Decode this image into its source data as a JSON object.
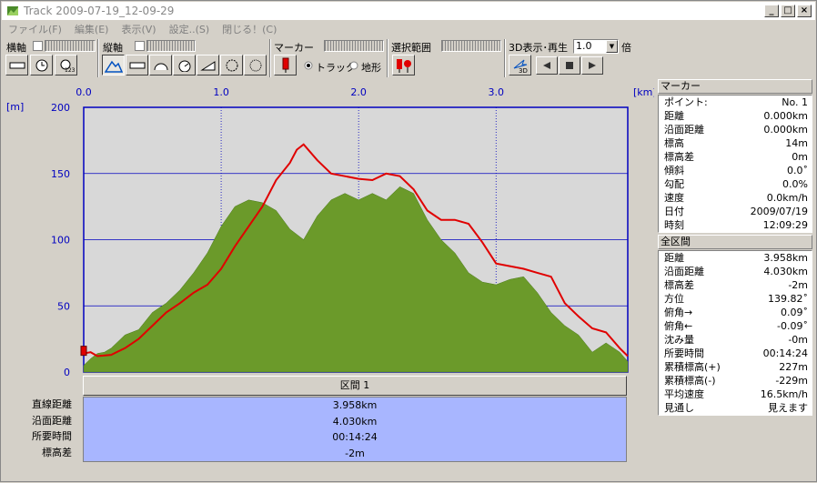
{
  "window": {
    "title": "Track  2009-07-19_12-09-29",
    "min": "_",
    "max": "□",
    "close": "×"
  },
  "menu": [
    "ファイル(F)",
    "編集(E)",
    "表示(V)",
    "設定..(S)",
    "閉じる！(C)"
  ],
  "toolbar": {
    "horiz_label": "横軸",
    "vert_label": "縦軸",
    "marker_label": "マーカー",
    "range_label": "選択範囲",
    "play_label": "3D表示･再生",
    "speed_value": "1.0",
    "speed_unit": "倍",
    "radio_track": "トラック",
    "radio_terrain": "地形",
    "btn_3d": "3D"
  },
  "chart_data": {
    "type": "area",
    "xlabel": "",
    "ylabel": "",
    "x_unit": "[km]",
    "y_unit": "[m]",
    "xlim": [
      0,
      3.958
    ],
    "ylim": [
      0,
      200
    ],
    "x_ticks": [
      "0.0",
      "1.0",
      "2.0",
      "3.0"
    ],
    "y_ticks": [
      "0",
      "50",
      "100",
      "150",
      "200"
    ],
    "series": [
      {
        "role": "terrain",
        "color": "#6b9a2a",
        "x": [
          0,
          0.05,
          0.1,
          0.15,
          0.2,
          0.3,
          0.4,
          0.5,
          0.6,
          0.7,
          0.8,
          0.9,
          1.0,
          1.1,
          1.2,
          1.3,
          1.4,
          1.5,
          1.6,
          1.7,
          1.8,
          1.9,
          2.0,
          2.1,
          2.2,
          2.3,
          2.4,
          2.5,
          2.6,
          2.7,
          2.8,
          2.9,
          3.0,
          3.1,
          3.2,
          3.3,
          3.4,
          3.5,
          3.6,
          3.7,
          3.8,
          3.9,
          3.958
        ],
        "values": [
          5,
          10,
          14,
          15,
          18,
          28,
          32,
          45,
          52,
          62,
          75,
          90,
          110,
          125,
          130,
          128,
          122,
          108,
          100,
          118,
          130,
          135,
          130,
          135,
          130,
          140,
          135,
          115,
          100,
          90,
          75,
          68,
          66,
          70,
          72,
          60,
          45,
          35,
          28,
          15,
          22,
          15,
          8
        ]
      },
      {
        "role": "track",
        "color": "#e00000",
        "x": [
          0,
          0.05,
          0.1,
          0.2,
          0.3,
          0.4,
          0.5,
          0.6,
          0.7,
          0.8,
          0.9,
          1.0,
          1.1,
          1.2,
          1.3,
          1.4,
          1.5,
          1.55,
          1.6,
          1.7,
          1.8,
          1.9,
          2.0,
          2.1,
          2.2,
          2.3,
          2.4,
          2.5,
          2.6,
          2.7,
          2.8,
          2.9,
          3.0,
          3.1,
          3.2,
          3.3,
          3.4,
          3.5,
          3.6,
          3.7,
          3.8,
          3.9,
          3.958
        ],
        "values": [
          14,
          15,
          12,
          13,
          18,
          25,
          35,
          45,
          52,
          60,
          66,
          78,
          95,
          110,
          125,
          145,
          158,
          168,
          172,
          160,
          150,
          148,
          146,
          145,
          150,
          148,
          138,
          122,
          115,
          115,
          112,
          98,
          82,
          80,
          78,
          75,
          72,
          52,
          42,
          33,
          30,
          18,
          12
        ]
      }
    ]
  },
  "marker_panel": {
    "title": "マーカー",
    "rows": [
      {
        "k": "ポイント:",
        "v": "No. 1"
      },
      {
        "k": "距離",
        "v": "0.000km"
      },
      {
        "k": "沿面距離",
        "v": "0.000km"
      },
      {
        "k": "標高",
        "v": "14m"
      },
      {
        "k": "標高差",
        "v": "0m"
      },
      {
        "k": "傾斜",
        "v": "0.0˚"
      },
      {
        "k": "勾配",
        "v": "0.0%"
      },
      {
        "k": "速度",
        "v": "0.0km/h"
      },
      {
        "k": "日付",
        "v": "2009/07/19"
      },
      {
        "k": "時刻",
        "v": "12:09:29"
      }
    ]
  },
  "total_panel": {
    "title": "全区間",
    "rows": [
      {
        "k": "距離",
        "v": "3.958km"
      },
      {
        "k": "沿面距離",
        "v": "4.030km"
      },
      {
        "k": "標高差",
        "v": "-2m"
      },
      {
        "k": "方位",
        "v": "139.82˚"
      },
      {
        "k": "俯角→",
        "v": "0.09˚"
      },
      {
        "k": "俯角←",
        "v": "-0.09˚"
      },
      {
        "k": "沈み量",
        "v": "-0m"
      },
      {
        "k": "所要時間",
        "v": "00:14:24"
      },
      {
        "k": "累積標高(+)",
        "v": "227m"
      },
      {
        "k": "累積標高(-)",
        "v": "-229m"
      },
      {
        "k": "平均速度",
        "v": "16.5km/h"
      },
      {
        "k": "見通し",
        "v": "見えます"
      }
    ]
  },
  "segment": {
    "title": "区間 1",
    "labels": [
      "直線距離",
      "沿面距離",
      "所要時間",
      "標高差"
    ],
    "values": [
      "3.958km",
      "4.030km",
      "00:14:24",
      "-2m"
    ]
  }
}
